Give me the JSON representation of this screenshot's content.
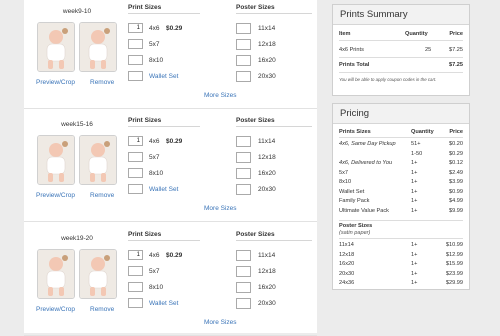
{
  "blocks": [
    {
      "week": "week9-10",
      "print_header": "Print Sizes",
      "poster_header": "Poster Sizes",
      "print_sizes": [
        {
          "qty": "1",
          "label": "4x6",
          "price": "$0.29"
        },
        {
          "qty": "",
          "label": "5x7"
        },
        {
          "qty": "",
          "label": "8x10"
        },
        {
          "qty": "",
          "label": "Wallet Set",
          "link": true
        }
      ],
      "poster_sizes": [
        "11x14",
        "12x18",
        "16x20",
        "20x30"
      ],
      "preview": "Preview/Crop",
      "remove": "Remove",
      "more": "More Sizes"
    },
    {
      "week": "week15-16",
      "print_header": "Print Sizes",
      "poster_header": "Poster Sizes",
      "print_sizes": [
        {
          "qty": "1",
          "label": "4x6",
          "price": "$0.29"
        },
        {
          "qty": "",
          "label": "5x7"
        },
        {
          "qty": "",
          "label": "8x10"
        },
        {
          "qty": "",
          "label": "Wallet Set",
          "link": true
        }
      ],
      "poster_sizes": [
        "11x14",
        "12x18",
        "16x20",
        "20x30"
      ],
      "preview": "Preview/Crop",
      "remove": "Remove",
      "more": "More Sizes"
    },
    {
      "week": "week19-20",
      "print_header": "Print Sizes",
      "poster_header": "Poster Sizes",
      "print_sizes": [
        {
          "qty": "1",
          "label": "4x6",
          "price": "$0.29"
        },
        {
          "qty": "",
          "label": "5x7"
        },
        {
          "qty": "",
          "label": "8x10"
        },
        {
          "qty": "",
          "label": "Wallet Set",
          "link": true
        }
      ],
      "poster_sizes": [
        "11x14",
        "12x18",
        "16x20",
        "20x30"
      ],
      "preview": "Preview/Crop",
      "remove": "Remove",
      "more": "More Sizes"
    }
  ],
  "summary": {
    "title": "Prints Summary",
    "headers": {
      "item": "Item",
      "quantity": "Quantity",
      "price": "Price"
    },
    "rows": [
      {
        "item": "4x6 Prints",
        "quantity": "25",
        "price": "$7.25"
      }
    ],
    "total": {
      "label": "Prints Total",
      "price": "$7.25"
    },
    "note": "You will be able to apply coupon codes in the cart."
  },
  "pricing": {
    "title": "Pricing",
    "print_headers": {
      "item": "Prints Sizes",
      "quantity": "Quantity",
      "price": "Price"
    },
    "print_rows": [
      {
        "item": "4x6, Same Day Pickup",
        "quantity": "51+",
        "price": "$0.20",
        "italic": true
      },
      {
        "item": "",
        "quantity": "1-50",
        "price": "$0.29"
      },
      {
        "item": "4x6, Delivered to You",
        "quantity": "1+",
        "price": "$0.12",
        "italic": true
      },
      {
        "item": "5x7",
        "quantity": "1+",
        "price": "$2.49"
      },
      {
        "item": "8x10",
        "quantity": "1+",
        "price": "$3.99"
      },
      {
        "item": "Wallet Set",
        "quantity": "1+",
        "price": "$0.99"
      },
      {
        "item": "Family Pack",
        "quantity": "1+",
        "price": "$4.99"
      },
      {
        "item": "Ultimate Value Pack",
        "quantity": "1+",
        "price": "$9.99"
      }
    ],
    "poster_header": "Poster Sizes",
    "poster_sub": "(satin paper)",
    "poster_rows": [
      {
        "item": "11x14",
        "quantity": "1+",
        "price": "$10.99"
      },
      {
        "item": "12x18",
        "quantity": "1+",
        "price": "$12.99"
      },
      {
        "item": "16x20",
        "quantity": "1+",
        "price": "$15.99"
      },
      {
        "item": "20x30",
        "quantity": "1+",
        "price": "$23.99"
      },
      {
        "item": "24x36",
        "quantity": "1+",
        "price": "$29.99"
      }
    ]
  },
  "colors": {
    "link": "#3a74b8",
    "border": "#cfcfcf",
    "header_bg": "#f2f2f2"
  }
}
